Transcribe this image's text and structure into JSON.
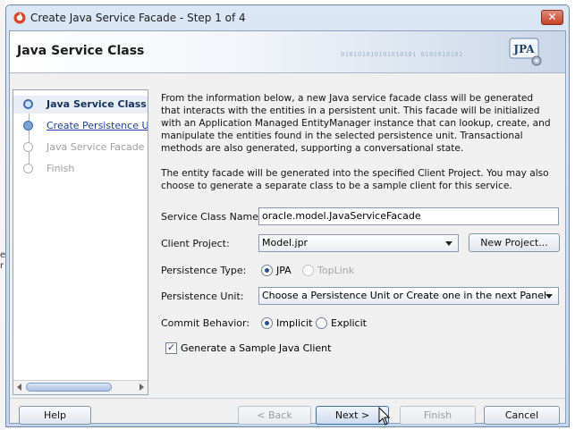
{
  "window": {
    "title": "Create Java Service Facade - Step 1 of 4",
    "close_glyph": "✕"
  },
  "header": {
    "title": "Java Service Class",
    "logo_text": "JPA",
    "binary_text": "010101010101010101  0101010101"
  },
  "nav": {
    "items": [
      {
        "label": "Java Service Class",
        "state": "active"
      },
      {
        "label": "Create Persistence Unit",
        "state": "link"
      },
      {
        "label": "Java Service Facade Me",
        "state": "disabled"
      },
      {
        "label": "Finish",
        "state": "disabled"
      }
    ]
  },
  "content": {
    "description": "From the information below, a new Java service facade class will be generated that interacts with the entities in a persistent unit.  This facade will be initialized with an Application Managed EntityManager instance that can lookup, create, and manipulate the entities found in the selected persistence unit.  Transactional methods are also generated, supporting a conversational state.",
    "client_note": "The entity facade will be generated into the specified Client Project.  You may also choose to generate a separate class to be a sample client for this service.",
    "service_class": {
      "label": "Service Class Name:",
      "value": "oracle.model.JavaServiceFacade"
    },
    "client_project": {
      "label": "Client Project:",
      "value": "Model.jpr",
      "new_button": "New Project..."
    },
    "persistence_type": {
      "label": "Persistence Type:",
      "options": [
        "JPA",
        "TopLink"
      ],
      "selected": "JPA"
    },
    "persistence_unit": {
      "label": "Persistence Unit:",
      "value": "Choose a Persistence Unit or Create one in the next Panel"
    },
    "commit_behavior": {
      "label": "Commit Behavior:",
      "options": [
        "Implicit",
        "Explicit"
      ],
      "selected": "Implicit"
    },
    "sample_client": {
      "label": "Generate a Sample Java Client",
      "checked": true
    }
  },
  "buttons": {
    "help": "Help",
    "back": "< Back",
    "next": "Next >",
    "finish": "Finish",
    "cancel": "Cancel"
  },
  "colors": {
    "accent": "#2a4f88",
    "header_fade": "#cad7e8",
    "link": "#1c3f9a"
  }
}
